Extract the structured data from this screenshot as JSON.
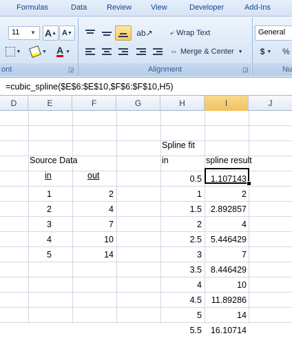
{
  "ribbon": {
    "tabs": [
      "Formulas",
      "Data",
      "Review",
      "View",
      "Developer",
      "Add-Ins"
    ],
    "font_size": "11",
    "wrap_text": "Wrap Text",
    "merge_center": "Merge & Center",
    "number_format": "General",
    "currency": "$",
    "percent": "%",
    "font_group_label": "ont",
    "alignment_group_label": "Alignment",
    "number_group_label": "Nu",
    "grow_font": "A",
    "shrink_font": "A",
    "font_color_letter": "A"
  },
  "formula_bar": {
    "text": "=cubic_spline($E$6:$E$10,$F$6:$F$10,H5)"
  },
  "columns": [
    "D",
    "E",
    "F",
    "G",
    "H",
    "I",
    "J"
  ],
  "sheet": {
    "spline_fit_label": "Spline fit",
    "source_data_label": "Source Data",
    "in_header_h": "in",
    "spline_result_header": "spline result",
    "source_in_header": "in",
    "source_out_header": "out",
    "source": [
      {
        "in": "1",
        "out": "2"
      },
      {
        "in": "2",
        "out": "4"
      },
      {
        "in": "3",
        "out": "7"
      },
      {
        "in": "4",
        "out": "10"
      },
      {
        "in": "5",
        "out": "14"
      }
    ],
    "fit": [
      {
        "in": "0.5",
        "result": "1.107143"
      },
      {
        "in": "1",
        "result": "2"
      },
      {
        "in": "1.5",
        "result": "2.892857"
      },
      {
        "in": "2",
        "result": "4"
      },
      {
        "in": "2.5",
        "result": "5.446429"
      },
      {
        "in": "3",
        "result": "7"
      },
      {
        "in": "3.5",
        "result": "8.446429"
      },
      {
        "in": "4",
        "result": "10"
      },
      {
        "in": "4.5",
        "result": "11.89286"
      },
      {
        "in": "5",
        "result": "14"
      },
      {
        "in": "5.5",
        "result": "16.10714"
      }
    ]
  }
}
